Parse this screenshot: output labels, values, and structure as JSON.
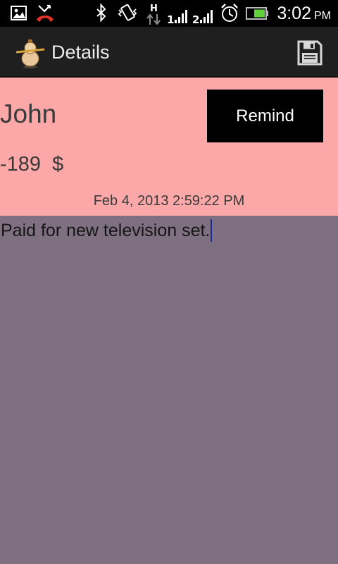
{
  "status_bar": {
    "time": "3:02",
    "ampm": "PM",
    "icons": [
      "image-icon",
      "missed-call-icon",
      "bluetooth-icon",
      "vibrate-icon",
      "hspa-data-icon",
      "signal-1-icon",
      "signal-2-icon",
      "alarm-icon",
      "battery-icon"
    ]
  },
  "action_bar": {
    "title": "Details",
    "app_icon": "gourd-app-icon",
    "save_icon": "floppy-disk-icon"
  },
  "details": {
    "name": "John",
    "remind_label": "Remind",
    "amount": "-189",
    "currency": "$",
    "timestamp": "Feb 4, 2013 2:59:22 PM"
  },
  "note": {
    "text": "Paid for new television set."
  },
  "colors": {
    "header_background": "#fca8a8",
    "note_background": "#7e7080",
    "action_bar_background": "#1f1f1f",
    "remind_button_background": "#000000"
  }
}
